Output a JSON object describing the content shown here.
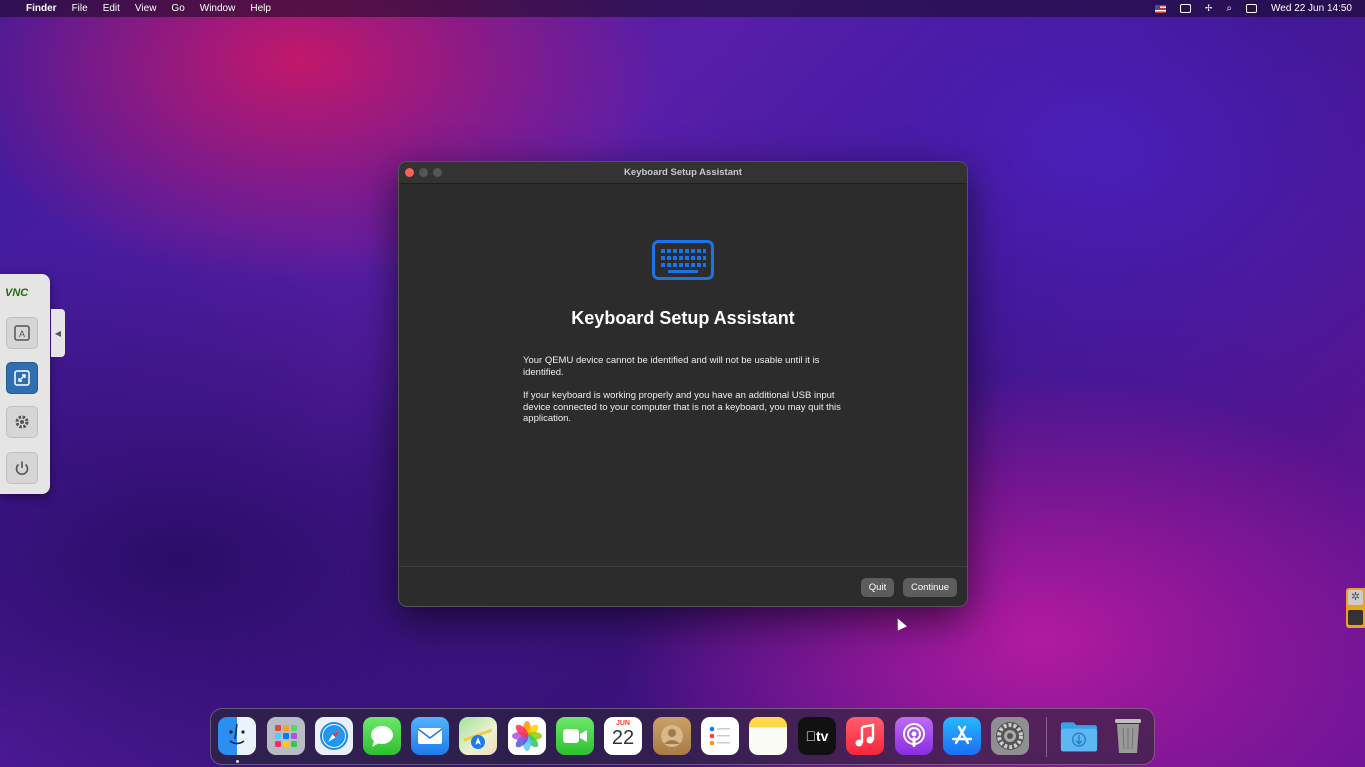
{
  "menubar": {
    "apple_symbol": "",
    "app_name": "Finder",
    "menus": [
      "File",
      "Edit",
      "View",
      "Go",
      "Window",
      "Help"
    ],
    "clock": "Wed 22 Jun  14:50"
  },
  "window": {
    "title": "Keyboard Setup Assistant",
    "heading": "Keyboard Setup Assistant",
    "paragraph1": "Your QEMU device cannot be identified and will not be usable until it is identified.",
    "paragraph2": "If your keyboard is working properly and you have an additional USB input device connected to your computer that is not a keyboard, you may quit this application.",
    "quit_label": "Quit",
    "continue_label": "Continue",
    "icon": "keyboard-icon",
    "accent_color": "#1a73e8"
  },
  "vnc_panel": {
    "logo": "VNC",
    "buttons": [
      "keyboard-a-icon",
      "scale-icon",
      "gear-icon",
      "power-icon"
    ]
  },
  "dock": {
    "calendar_month": "JUN",
    "calendar_day": "22",
    "tv_label": "tv",
    "apps": [
      "Finder",
      "Launchpad",
      "Safari",
      "Messages",
      "Mail",
      "Maps",
      "Photos",
      "FaceTime",
      "Calendar",
      "Contacts",
      "Reminders",
      "Notes",
      "TV",
      "Music",
      "Podcasts",
      "App Store",
      "System Preferences",
      "Downloads",
      "Trash"
    ]
  }
}
